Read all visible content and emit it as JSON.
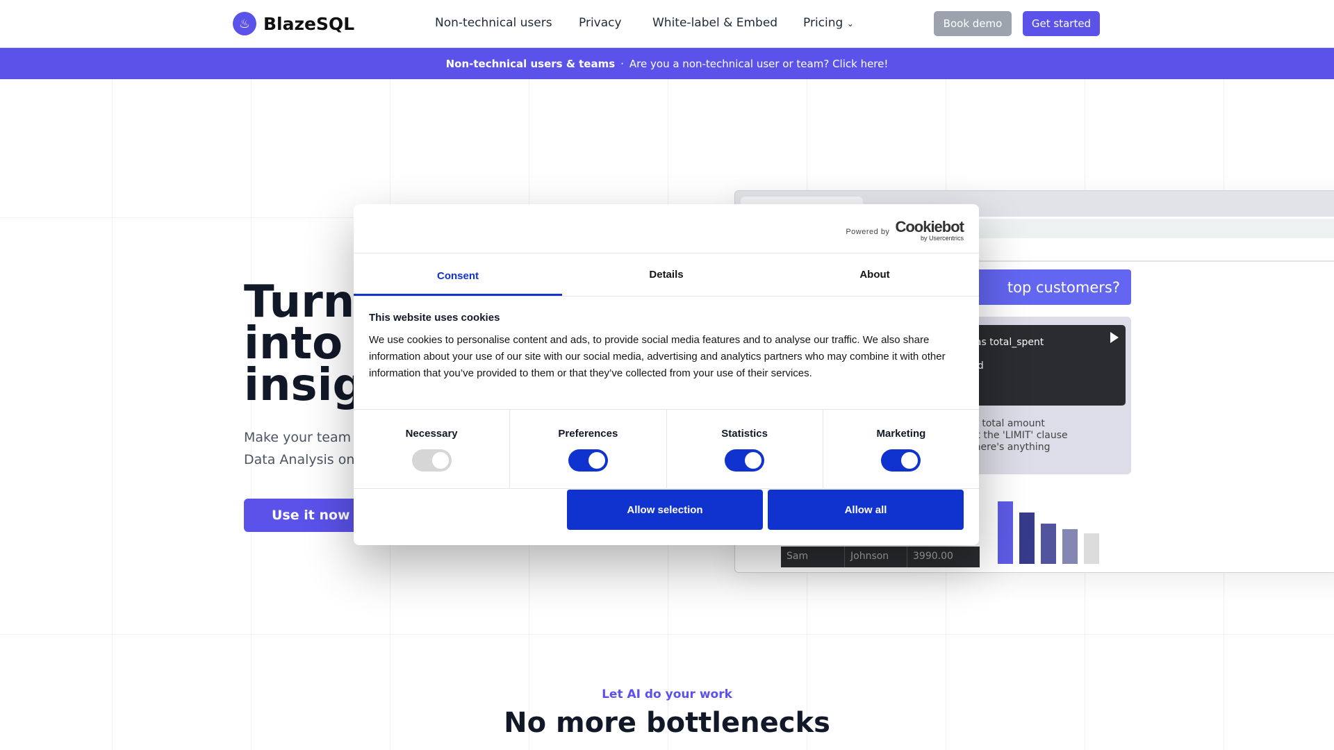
{
  "nav": {
    "brand": "BlazeSQL",
    "items": [
      "Non-technical users",
      "Privacy",
      "White-label & Embed",
      "Pricing"
    ],
    "book_demo": "Book demo",
    "get_started": "Get started"
  },
  "banner": {
    "bold": "Non-technical users & teams",
    "sep": "·",
    "text": "Are you a non-technical user or team? Click here!"
  },
  "hero": {
    "title_lines": [
      "Turn",
      "into d",
      "insig"
    ],
    "sub_lines": [
      "Make your team r",
      "Data Analysis on"
    ],
    "cta": "Use it now"
  },
  "preview": {
    "question": "top customers?",
    "code_lines": [
      "rice) as total_spent",
      "mer_id"
    ],
    "answer_lines": [
      "of the total amount",
      "adjust the 'LIMIT' clause",
      "w if there's anything"
    ],
    "table_row": [
      "Sam",
      "Johnson",
      "3990.00"
    ],
    "bar_colors": [
      "#5d5ce6",
      "#373b8c",
      "#52559e",
      "#8486b4",
      "#dcdcdc"
    ],
    "bar_values": [
      100,
      82,
      64,
      56,
      49
    ]
  },
  "cookie": {
    "powered_by": "Powered by",
    "brand": "Cookiebot",
    "brand_sub": "by Usercentrics",
    "tabs": [
      "Consent",
      "Details",
      "About"
    ],
    "title": "This website uses cookies",
    "body": "We use cookies to personalise content and ads, to provide social media features and to analyse our traffic. We also share information about your use of our site with our social media, advertising and analytics partners who may combine it with other information that you’ve provided to them or that they’ve collected from your use of their services.",
    "categories": [
      {
        "label": "Necessary",
        "on": true,
        "disabled": true
      },
      {
        "label": "Preferences",
        "on": true
      },
      {
        "label": "Statistics",
        "on": true
      },
      {
        "label": "Marketing",
        "on": true
      }
    ],
    "allow_selection": "Allow selection",
    "allow_all": "Allow all",
    "accent": "#1032cf"
  },
  "section": {
    "eyebrow": "Let AI do your work",
    "title": "No more bottlenecks"
  }
}
